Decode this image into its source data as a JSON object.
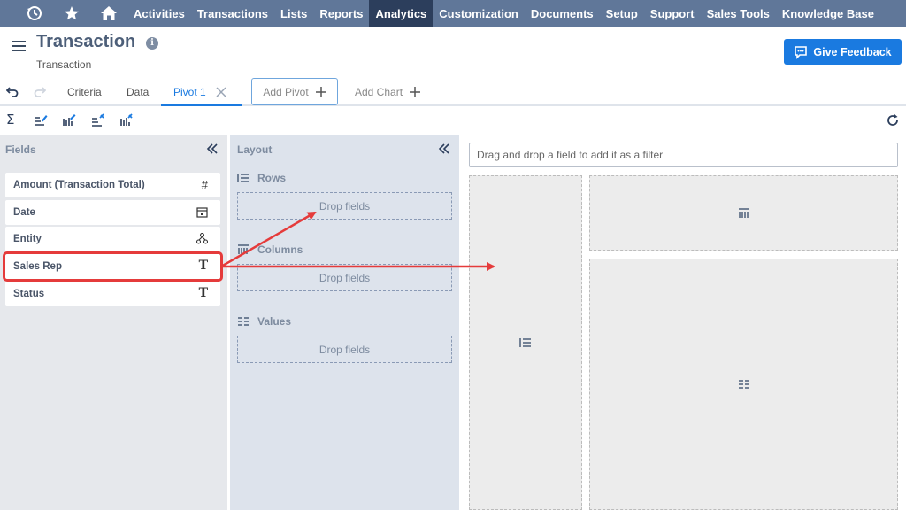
{
  "nav": {
    "items": [
      "Activities",
      "Transactions",
      "Lists",
      "Reports",
      "Analytics",
      "Customization",
      "Documents",
      "Setup",
      "Support",
      "Sales Tools",
      "Knowledge Base"
    ],
    "active": "Analytics",
    "icons": [
      "recent-icon",
      "star-icon",
      "home-icon"
    ]
  },
  "header": {
    "title": "Transaction",
    "subtitle": "Transaction",
    "feedback_label": "Give Feedback"
  },
  "tabs": {
    "criteria": "Criteria",
    "data": "Data",
    "pivot": "Pivot 1",
    "add_pivot": "Add Pivot",
    "add_chart": "Add Chart"
  },
  "fields_panel": {
    "title": "Fields",
    "items": [
      {
        "label": "Amount (Transaction Total)",
        "icon": "hash-icon"
      },
      {
        "label": "Date",
        "icon": "calendar-icon"
      },
      {
        "label": "Entity",
        "icon": "hierarchy-icon"
      },
      {
        "label": "Sales Rep",
        "icon": "text-icon"
      },
      {
        "label": "Status",
        "icon": "text-icon"
      }
    ]
  },
  "layout_panel": {
    "title": "Layout",
    "rows_label": "Rows",
    "columns_label": "Columns",
    "values_label": "Values",
    "drop_placeholder": "Drop fields"
  },
  "canvas": {
    "filter_placeholder": "Drag and drop a field to add it as a filter"
  },
  "colors": {
    "nav_bg": "#607799",
    "nav_active": "#2c3e5c",
    "accent": "#1a7ae0",
    "annotation": "#e53b3b"
  }
}
